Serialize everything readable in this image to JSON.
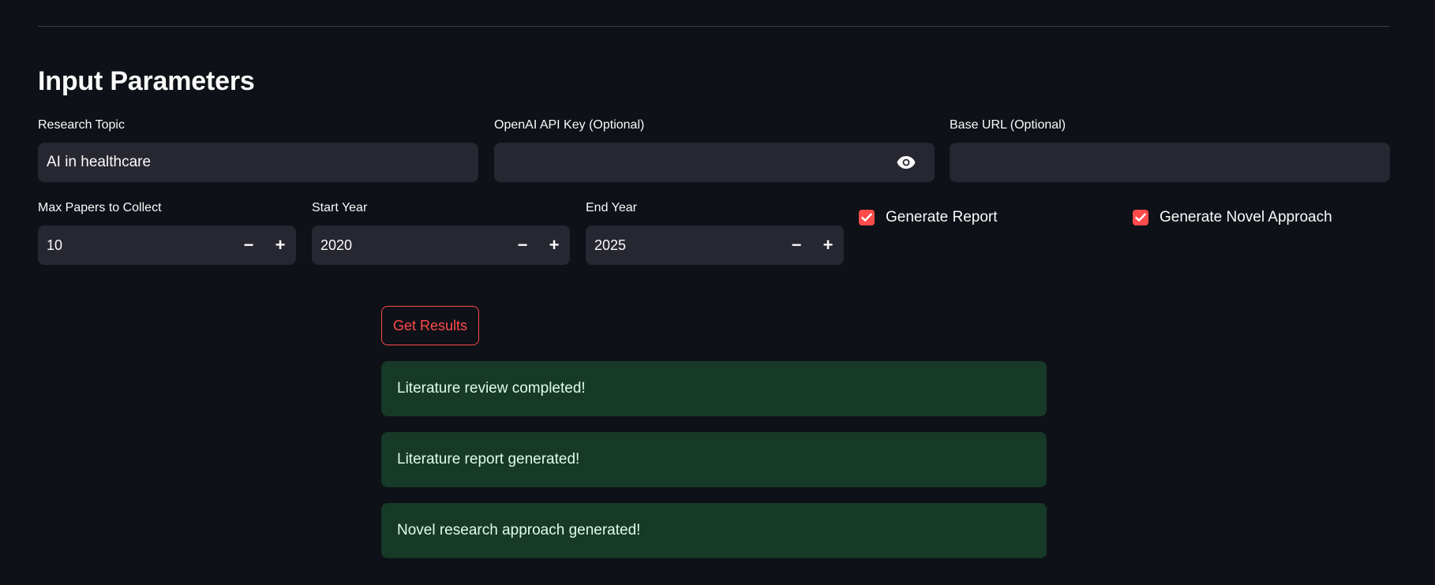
{
  "section": {
    "title": "Input Parameters"
  },
  "fields": {
    "research_topic": {
      "label": "Research Topic",
      "value": "AI in healthcare"
    },
    "api_key": {
      "label": "OpenAI API Key (Optional)",
      "value": ""
    },
    "base_url": {
      "label": "Base URL (Optional)",
      "value": ""
    },
    "max_papers": {
      "label": "Max Papers to Collect",
      "value": "10"
    },
    "start_year": {
      "label": "Start Year",
      "value": "2020"
    },
    "end_year": {
      "label": "End Year",
      "value": "2025"
    }
  },
  "stepper": {
    "minus": "−",
    "plus": "+"
  },
  "checkboxes": {
    "generate_report": {
      "label": "Generate Report",
      "checked": true
    },
    "generate_novel": {
      "label": "Generate Novel Approach",
      "checked": true
    }
  },
  "actions": {
    "get_results": "Get Results"
  },
  "alerts": [
    "Literature review completed!",
    "Literature report generated!",
    "Novel research approach generated!"
  ],
  "colors": {
    "background": "#0e1117",
    "input_bg": "#262730",
    "accent": "#ff4b4b",
    "success_bg": "#173928",
    "success_text": "#dffde9"
  },
  "icons": {
    "visibility": "eye-icon",
    "check": "check-icon"
  }
}
